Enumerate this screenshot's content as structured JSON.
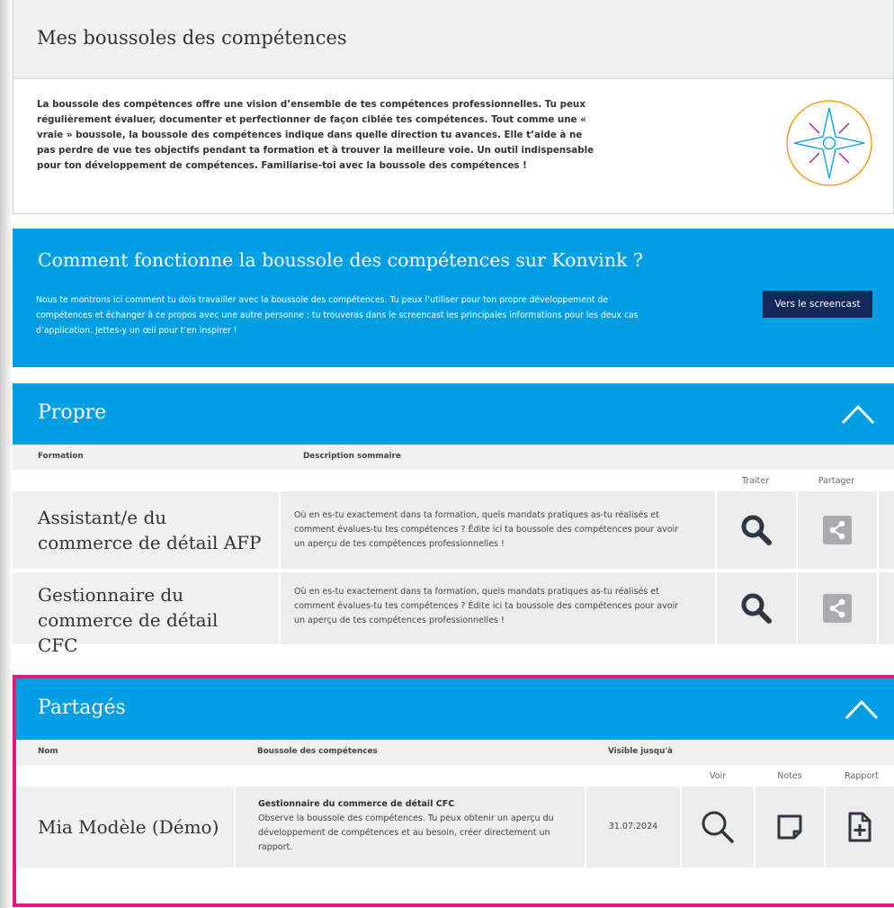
{
  "intro": {
    "title": "Mes boussoles des compétences",
    "text": "La boussole des compétences offre une vision d’ensemble de tes compétences professionnelles. Tu peux régulièrement évaluer, documenter et perfectionner de façon ciblée tes compétences. Tout comme une « vraie » boussole, la boussole des compétences indique dans quelle direction tu avances. Elle t’aide à ne pas perdre de vue tes objectifs pendant ta formation et à trouver la meilleure voie. Un outil indispensable pour ton développement de compétences. Familiarise-toi avec la boussole des compétences !",
    "icon": "compass-icon"
  },
  "howto": {
    "title": "Comment fonctionne la boussole des compétences sur Konvink ?",
    "text": "Nous te montrons ici comment tu dois travailler avec la boussole des compétences. Tu peux l’utiliser pour ton propre développement de compétences et échanger à ce propos avec une autre personne : tu trouveras dans le screencast les principales informations pour les deux cas d’application. Jettes-y un œil pour t’en inspirer !",
    "button_label": "Vers le screencast"
  },
  "own": {
    "title": "Propre",
    "columns": {
      "formation": "Formation",
      "description": "Description sommaire"
    },
    "actions": {
      "edit": "Traiter",
      "share": "Partager"
    },
    "rows": [
      {
        "formation": "Assistant/e du commerce de détail AFP",
        "description": "Où en es-tu exactement dans ta formation, quels mandats pratiques as-tu réalisés et comment évalues-tu tes compétences ? Édite ici ta boussole des compétences pour avoir un aperçu de tes compétences professionnelles !"
      },
      {
        "formation": "Gestionnaire du commerce de détail CFC",
        "description": "Où en es-tu exactement dans ta formation, quels mandats pratiques as-tu réalisés et comment évalues-tu tes compétences ? Édite ici ta boussole des compétences pour avoir un aperçu de tes compétences professionnelles !"
      }
    ]
  },
  "shared": {
    "title": "Partagés",
    "columns": {
      "name": "Nom",
      "compass": "Boussole des compétences",
      "visible": "Visible jusqu'à"
    },
    "actions": {
      "view": "Voir",
      "notes": "Notes",
      "report": "Rapport"
    },
    "rows": [
      {
        "name": "Mia Modèle (Démo)",
        "compass_title": "Gestionnaire du commerce de détail CFC",
        "compass_text": "Observe la boussole des compétences. Tu peux obtenir un aperçu du développement de compétences et au besoin, créer directement un rapport.",
        "visible_until": "31.07.2024"
      }
    ]
  },
  "colors": {
    "accent_blue": "#009fe3",
    "dark_navy": "#14295a",
    "highlight_frame": "#e0197d",
    "compass_orange": "#f39200",
    "compass_purple": "#a3238e",
    "compass_blue": "#009fe3"
  }
}
